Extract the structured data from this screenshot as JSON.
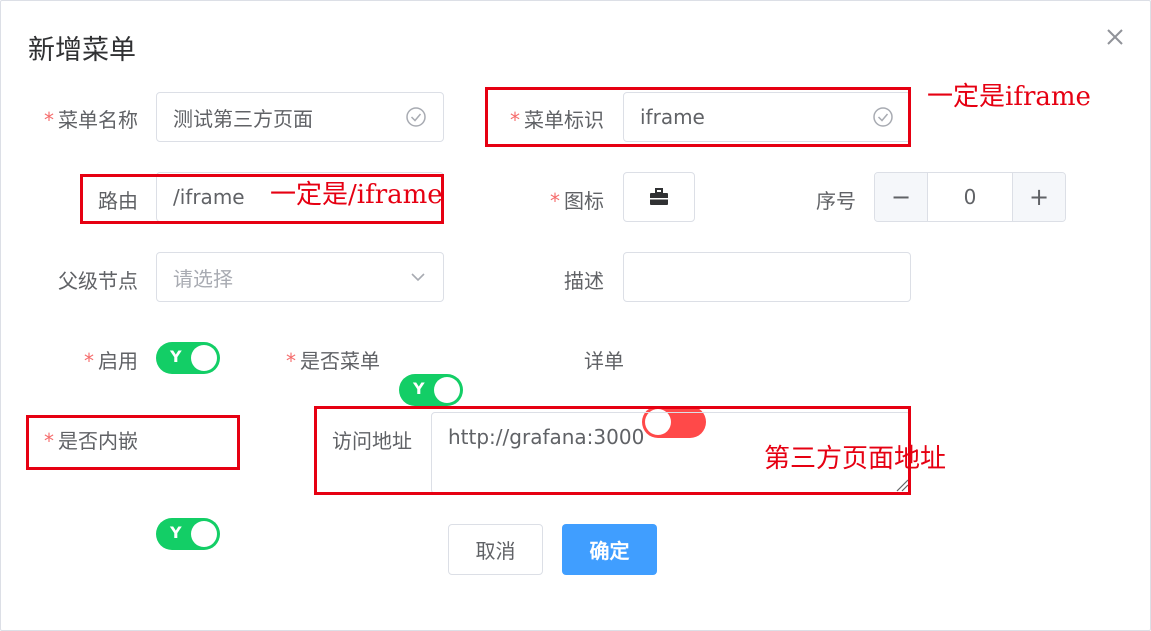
{
  "dialog": {
    "title": "新增菜单"
  },
  "form": {
    "menu_name": {
      "label": "菜单名称",
      "value": "测试第三方页面",
      "required": true
    },
    "menu_key": {
      "label": "菜单标识",
      "value": "iframe",
      "required": true
    },
    "route": {
      "label": "路由",
      "value": "/iframe",
      "required": false
    },
    "icon": {
      "label": "图标",
      "required": true,
      "icon_name": "briefcase-icon"
    },
    "order": {
      "label": "序号",
      "value": "0",
      "minus": "−",
      "plus": "+"
    },
    "parent": {
      "label": "父级节点",
      "placeholder": "请选择"
    },
    "description": {
      "label": "描述",
      "value": ""
    },
    "enabled": {
      "label": "启用",
      "required": true,
      "state": true,
      "text": "Y"
    },
    "is_menu": {
      "label": "是否菜单",
      "required": true,
      "state": true,
      "text": "Y"
    },
    "detail": {
      "label": "详单",
      "required": false,
      "state": false,
      "text": ""
    },
    "embedded": {
      "label": "是否内嵌",
      "required": true,
      "state": true,
      "text": "Y"
    },
    "url": {
      "label": "访问地址",
      "value": "http://grafana:3000"
    }
  },
  "buttons": {
    "cancel": "取消",
    "confirm": "确定"
  },
  "annotations": {
    "menu_key_note": "一定是iframe",
    "route_note": "一定是/iframe",
    "url_note": "第三方页面地址"
  },
  "colors": {
    "required_star": "#f56c6c",
    "switch_on": "#13ce66",
    "switch_off": "#ff4949",
    "primary": "#409eff",
    "annotation_red": "#e60012"
  }
}
